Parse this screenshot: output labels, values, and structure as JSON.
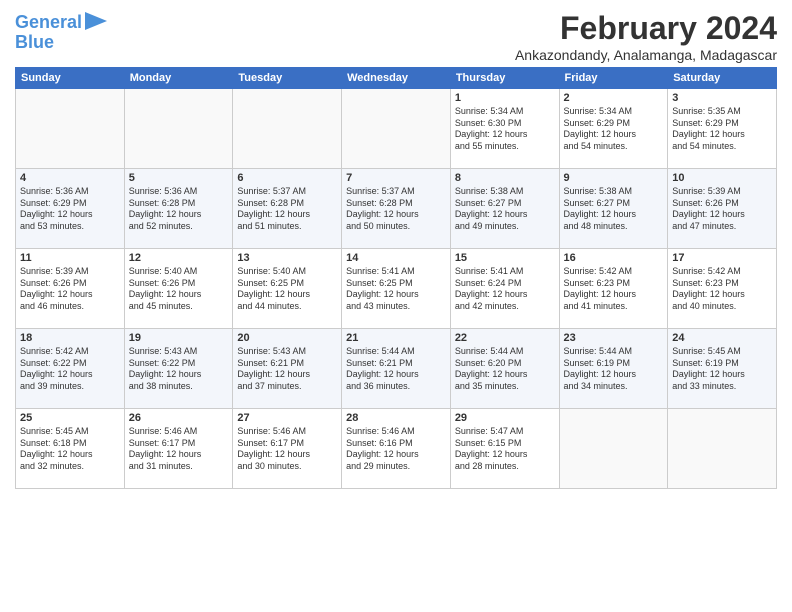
{
  "logo": {
    "line1": "General",
    "line2": "Blue"
  },
  "title": "February 2024",
  "location": "Ankazondandy, Analamanga, Madagascar",
  "days_of_week": [
    "Sunday",
    "Monday",
    "Tuesday",
    "Wednesday",
    "Thursday",
    "Friday",
    "Saturday"
  ],
  "weeks": [
    [
      {
        "day": "",
        "info": ""
      },
      {
        "day": "",
        "info": ""
      },
      {
        "day": "",
        "info": ""
      },
      {
        "day": "",
        "info": ""
      },
      {
        "day": "1",
        "info": "Sunrise: 5:34 AM\nSunset: 6:30 PM\nDaylight: 12 hours\nand 55 minutes."
      },
      {
        "day": "2",
        "info": "Sunrise: 5:34 AM\nSunset: 6:29 PM\nDaylight: 12 hours\nand 54 minutes."
      },
      {
        "day": "3",
        "info": "Sunrise: 5:35 AM\nSunset: 6:29 PM\nDaylight: 12 hours\nand 54 minutes."
      }
    ],
    [
      {
        "day": "4",
        "info": "Sunrise: 5:36 AM\nSunset: 6:29 PM\nDaylight: 12 hours\nand 53 minutes."
      },
      {
        "day": "5",
        "info": "Sunrise: 5:36 AM\nSunset: 6:28 PM\nDaylight: 12 hours\nand 52 minutes."
      },
      {
        "day": "6",
        "info": "Sunrise: 5:37 AM\nSunset: 6:28 PM\nDaylight: 12 hours\nand 51 minutes."
      },
      {
        "day": "7",
        "info": "Sunrise: 5:37 AM\nSunset: 6:28 PM\nDaylight: 12 hours\nand 50 minutes."
      },
      {
        "day": "8",
        "info": "Sunrise: 5:38 AM\nSunset: 6:27 PM\nDaylight: 12 hours\nand 49 minutes."
      },
      {
        "day": "9",
        "info": "Sunrise: 5:38 AM\nSunset: 6:27 PM\nDaylight: 12 hours\nand 48 minutes."
      },
      {
        "day": "10",
        "info": "Sunrise: 5:39 AM\nSunset: 6:26 PM\nDaylight: 12 hours\nand 47 minutes."
      }
    ],
    [
      {
        "day": "11",
        "info": "Sunrise: 5:39 AM\nSunset: 6:26 PM\nDaylight: 12 hours\nand 46 minutes."
      },
      {
        "day": "12",
        "info": "Sunrise: 5:40 AM\nSunset: 6:26 PM\nDaylight: 12 hours\nand 45 minutes."
      },
      {
        "day": "13",
        "info": "Sunrise: 5:40 AM\nSunset: 6:25 PM\nDaylight: 12 hours\nand 44 minutes."
      },
      {
        "day": "14",
        "info": "Sunrise: 5:41 AM\nSunset: 6:25 PM\nDaylight: 12 hours\nand 43 minutes."
      },
      {
        "day": "15",
        "info": "Sunrise: 5:41 AM\nSunset: 6:24 PM\nDaylight: 12 hours\nand 42 minutes."
      },
      {
        "day": "16",
        "info": "Sunrise: 5:42 AM\nSunset: 6:23 PM\nDaylight: 12 hours\nand 41 minutes."
      },
      {
        "day": "17",
        "info": "Sunrise: 5:42 AM\nSunset: 6:23 PM\nDaylight: 12 hours\nand 40 minutes."
      }
    ],
    [
      {
        "day": "18",
        "info": "Sunrise: 5:42 AM\nSunset: 6:22 PM\nDaylight: 12 hours\nand 39 minutes."
      },
      {
        "day": "19",
        "info": "Sunrise: 5:43 AM\nSunset: 6:22 PM\nDaylight: 12 hours\nand 38 minutes."
      },
      {
        "day": "20",
        "info": "Sunrise: 5:43 AM\nSunset: 6:21 PM\nDaylight: 12 hours\nand 37 minutes."
      },
      {
        "day": "21",
        "info": "Sunrise: 5:44 AM\nSunset: 6:21 PM\nDaylight: 12 hours\nand 36 minutes."
      },
      {
        "day": "22",
        "info": "Sunrise: 5:44 AM\nSunset: 6:20 PM\nDaylight: 12 hours\nand 35 minutes."
      },
      {
        "day": "23",
        "info": "Sunrise: 5:44 AM\nSunset: 6:19 PM\nDaylight: 12 hours\nand 34 minutes."
      },
      {
        "day": "24",
        "info": "Sunrise: 5:45 AM\nSunset: 6:19 PM\nDaylight: 12 hours\nand 33 minutes."
      }
    ],
    [
      {
        "day": "25",
        "info": "Sunrise: 5:45 AM\nSunset: 6:18 PM\nDaylight: 12 hours\nand 32 minutes."
      },
      {
        "day": "26",
        "info": "Sunrise: 5:46 AM\nSunset: 6:17 PM\nDaylight: 12 hours\nand 31 minutes."
      },
      {
        "day": "27",
        "info": "Sunrise: 5:46 AM\nSunset: 6:17 PM\nDaylight: 12 hours\nand 30 minutes."
      },
      {
        "day": "28",
        "info": "Sunrise: 5:46 AM\nSunset: 6:16 PM\nDaylight: 12 hours\nand 29 minutes."
      },
      {
        "day": "29",
        "info": "Sunrise: 5:47 AM\nSunset: 6:15 PM\nDaylight: 12 hours\nand 28 minutes."
      },
      {
        "day": "",
        "info": ""
      },
      {
        "day": "",
        "info": ""
      }
    ]
  ]
}
